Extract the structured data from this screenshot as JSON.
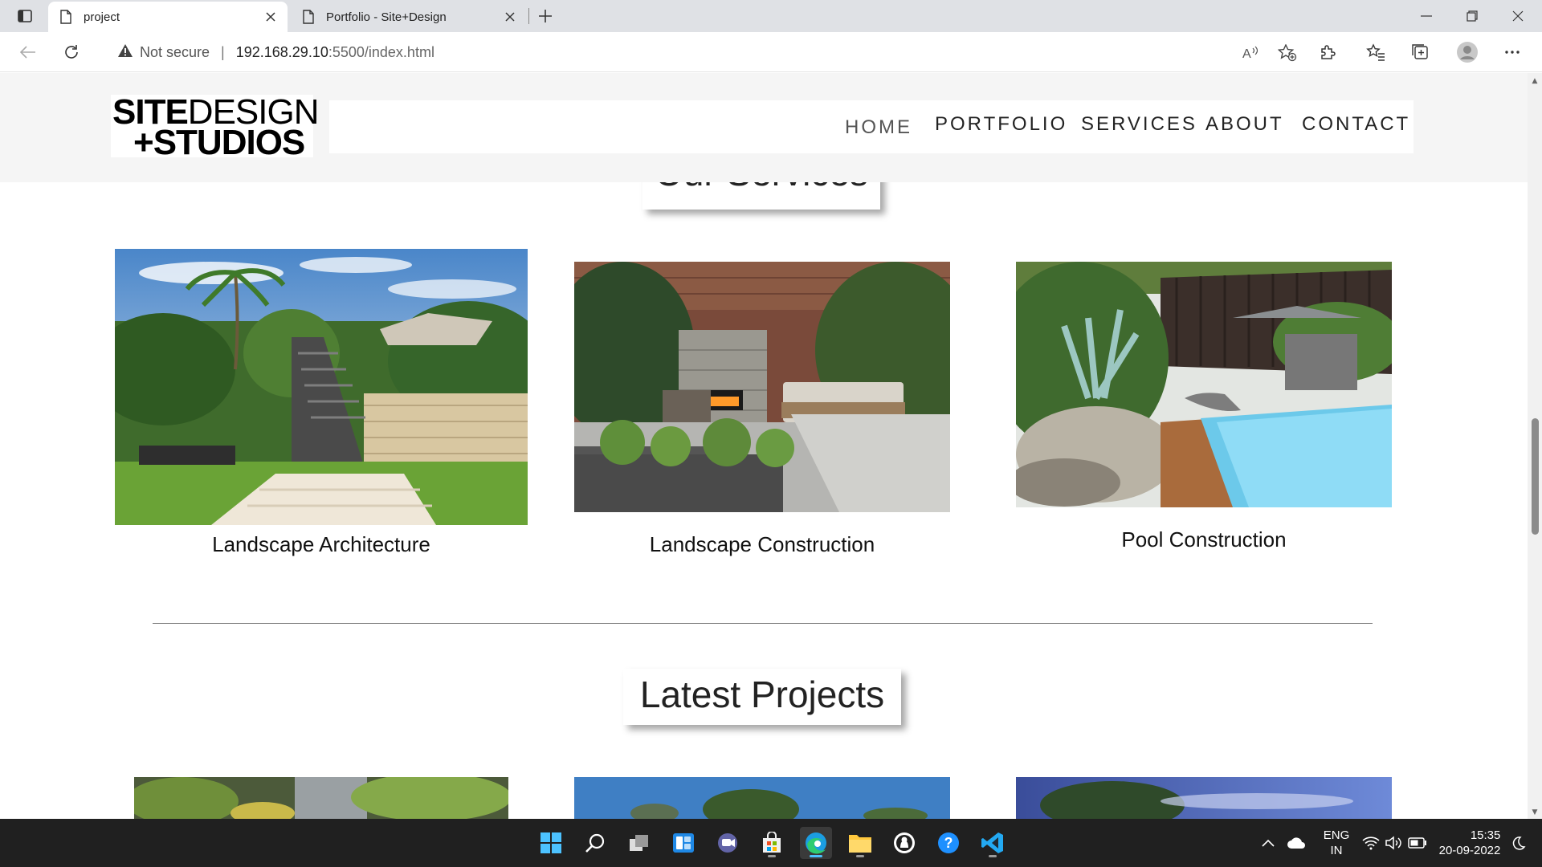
{
  "browser": {
    "tabs": [
      {
        "title": "project",
        "active": true
      },
      {
        "title": "Portfolio - Site+Design",
        "active": false
      }
    ],
    "address": {
      "security_label": "Not secure",
      "host": "192.168.29.10",
      "path": ":5500/index.html"
    }
  },
  "site": {
    "logo": {
      "line1_bold": "SITE",
      "line1_light": "DESIGN",
      "line2": "+STUDIOS"
    },
    "nav": [
      {
        "label": "HOME",
        "active": true
      },
      {
        "label": "PORTFOLIO",
        "active": false
      },
      {
        "label": "SERVICES",
        "active": false
      },
      {
        "label": "ABOUT",
        "active": false
      },
      {
        "label": "CONTACT",
        "active": false
      }
    ],
    "services_title": "Our Services",
    "services": [
      {
        "caption": "Landscape Architecture"
      },
      {
        "caption": "Landscape Construction"
      },
      {
        "caption": "Pool Construction"
      }
    ],
    "projects_title": "Latest Projects"
  },
  "taskbar": {
    "lang": "ENG",
    "region": "IN",
    "time": "15:35",
    "date": "20-09-2022"
  }
}
